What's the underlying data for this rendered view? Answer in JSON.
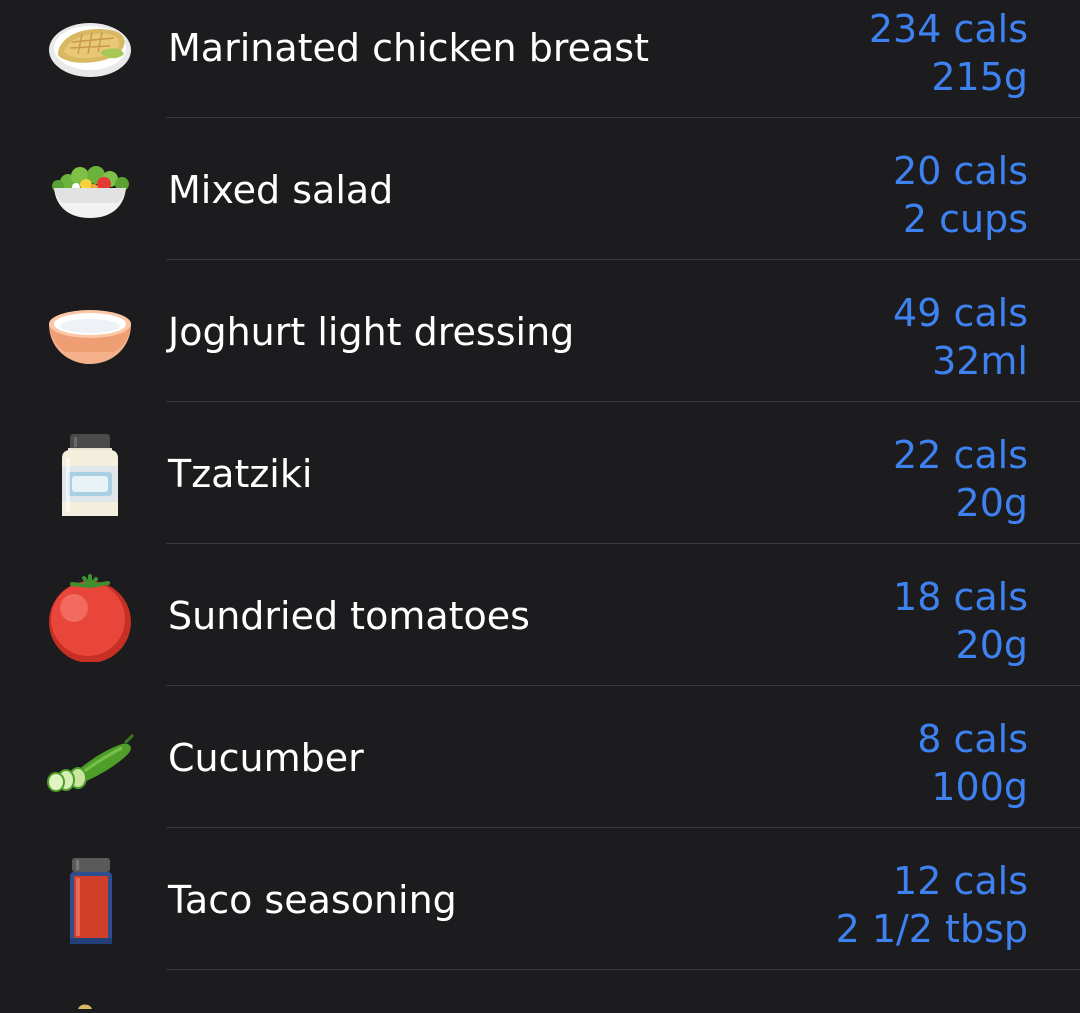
{
  "foods": [
    {
      "name": "Marinated chicken breast",
      "cals": "234 cals",
      "qty": "215g",
      "icon": "chicken-breast-icon"
    },
    {
      "name": "Mixed salad",
      "cals": "20 cals",
      "qty": "2 cups",
      "icon": "salad-bowl-icon"
    },
    {
      "name": "Joghurt light dressing",
      "cals": "49 cals",
      "qty": "32ml",
      "icon": "yogurt-bowl-icon"
    },
    {
      "name": "Tzatziki",
      "cals": "22 cals",
      "qty": "20g",
      "icon": "jar-icon"
    },
    {
      "name": "Sundried tomatoes",
      "cals": "18 cals",
      "qty": "20g",
      "icon": "tomato-icon"
    },
    {
      "name": "Cucumber",
      "cals": "8 cals",
      "qty": "100g",
      "icon": "cucumber-icon"
    },
    {
      "name": "Taco seasoning",
      "cals": "12 cals",
      "qty": "2 1/2 tbsp",
      "icon": "spice-bottle-icon"
    }
  ],
  "colors": {
    "background": "#1c1c1e",
    "separator": "#38383a",
    "accent": "#3e82f2",
    "text": "#ffffff"
  }
}
